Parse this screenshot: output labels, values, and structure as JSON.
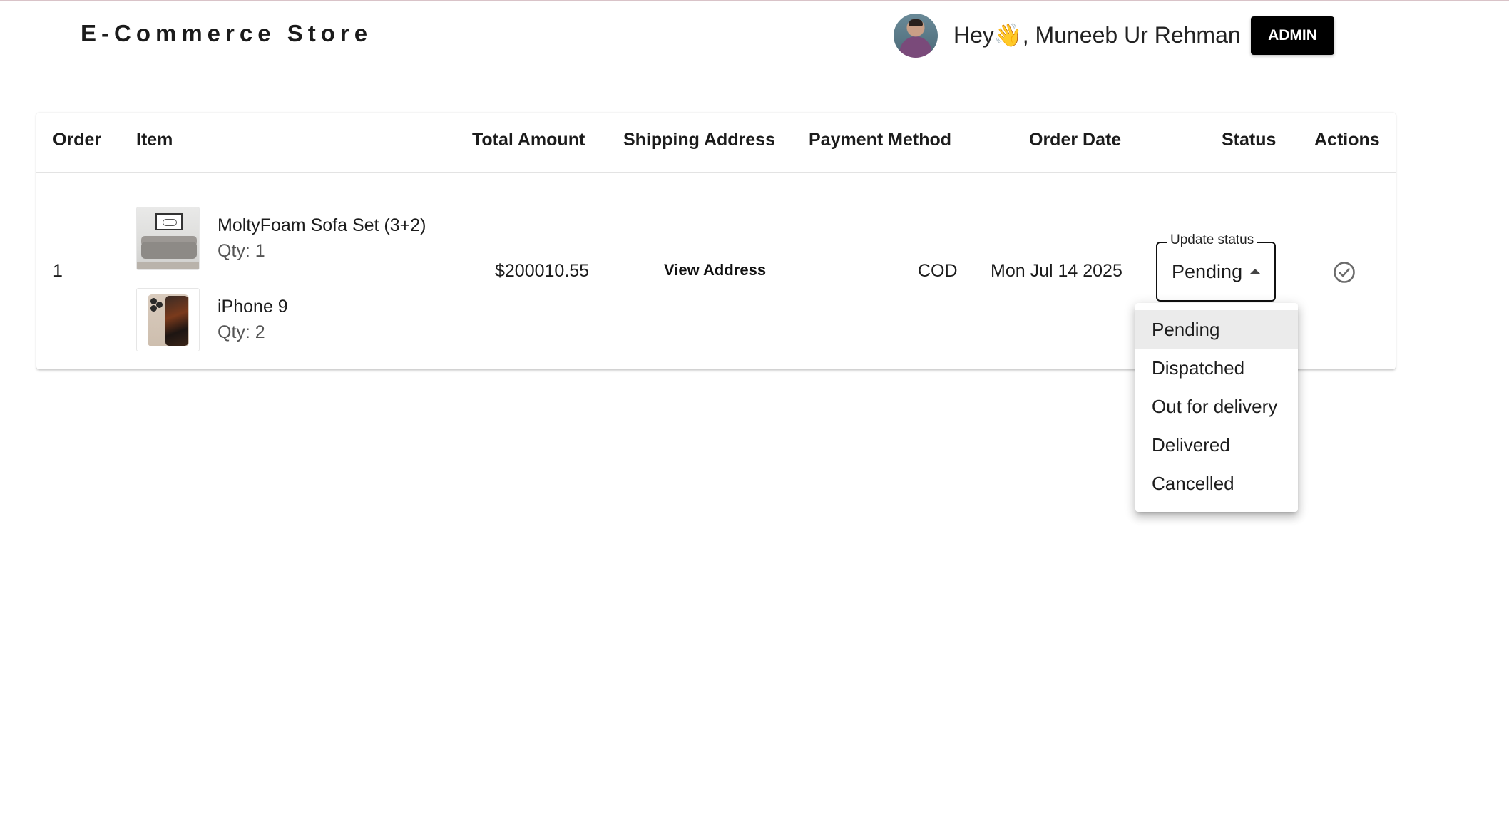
{
  "header": {
    "brand": "E-Commerce Store",
    "greeting_prefix": "Hey",
    "wave": "👋",
    "greeting_name": ", Muneeb Ur Rehman",
    "admin_label": "ADMIN"
  },
  "table": {
    "columns": [
      "Order",
      "Item",
      "Total Amount",
      "Shipping Address",
      "Payment Method",
      "Order Date",
      "Status",
      "Actions"
    ],
    "rows": [
      {
        "order": "1",
        "items": [
          {
            "name": "MoltyFoam Sofa Set (3+2)",
            "qty": "Qty: 1"
          },
          {
            "name": "iPhone 9",
            "qty": "Qty: 2"
          }
        ],
        "total": "$200010.55",
        "shipping_link": "View Address",
        "payment": "COD",
        "date": "Mon Jul 14 2025",
        "status_legend": "Update status",
        "status_value": "Pending"
      }
    ]
  },
  "status_menu": {
    "options": [
      "Pending",
      "Dispatched",
      "Out for delivery",
      "Delivered",
      "Cancelled"
    ],
    "selected": "Pending"
  },
  "icons": {
    "avatar": "user-avatar",
    "caret": "caret-up-icon",
    "action": "check-circle-icon"
  },
  "colors": {
    "admin_bg": "#000000",
    "selected_option_bg": "#ebebeb",
    "topline": "#d9c3c8"
  }
}
